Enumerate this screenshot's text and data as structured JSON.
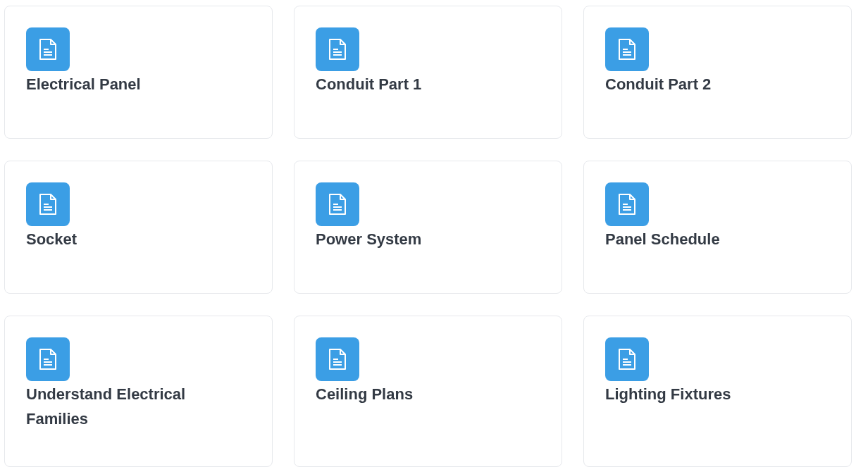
{
  "cards": [
    {
      "title": "Electrical Panel"
    },
    {
      "title": "Conduit Part 1"
    },
    {
      "title": "Conduit Part 2"
    },
    {
      "title": "Socket"
    },
    {
      "title": "Power System"
    },
    {
      "title": "Panel Schedule"
    },
    {
      "title": "Understand Electrical Families"
    },
    {
      "title": "Ceiling Plans"
    },
    {
      "title": "Lighting Fixtures"
    }
  ]
}
